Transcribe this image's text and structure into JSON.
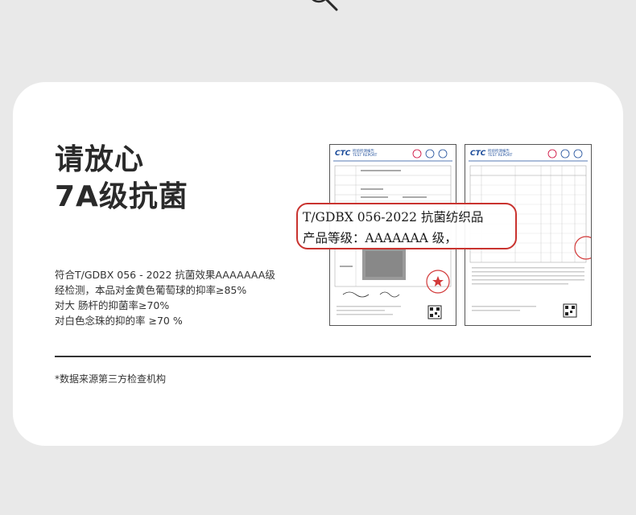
{
  "heading": {
    "line1": "请放心",
    "line2": "7A级抗菌"
  },
  "description": {
    "line1": "符合T/GDBX 056 - 2022 抗菌效果AAAAAAA级",
    "line2": "经检测，本品对金黄色葡萄球的抑率≥85%",
    "line3": "对大 肠杆的抑菌率≥70%",
    "line4": "对白色念珠的抑的率 ≥70 %"
  },
  "footnote": "*数据来源第三方检查机构",
  "report": {
    "logo": "CTC",
    "header_cn": "检验检测报告",
    "header_en": "TEST REPORT"
  },
  "callout": {
    "line1": "T/GDBX 056-2022  抗菌纺织品",
    "line2": "产品等级：AAAAAAA 级，"
  },
  "colors": {
    "callout_border": "#c9332f",
    "report_blue": "#1c4c9a",
    "stamp_red": "#d23a3a"
  },
  "icons": [
    "magnifier-icon",
    "qr-code-icon",
    "stamp-icon"
  ]
}
